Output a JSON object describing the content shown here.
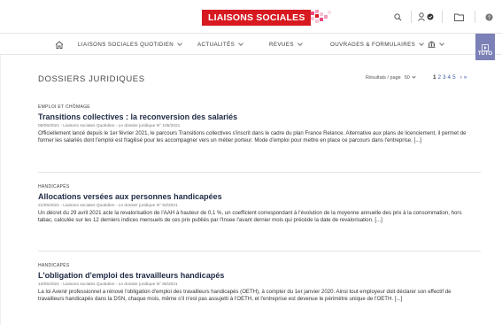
{
  "header": {
    "logo_text": "LIAISONS SOCIALES",
    "brand_color": "#d71920",
    "icons": [
      "search-icon",
      "user-icon",
      "folder-icon",
      "help-icon"
    ]
  },
  "nav": {
    "home_icon": "home-icon",
    "items": [
      {
        "label": "LIAISONS SOCIALES QUOTIDIEN"
      },
      {
        "label": "ACTUALITÉS"
      },
      {
        "label": "REVUES"
      },
      {
        "label": "OUVRAGES & FORMULAIRES"
      }
    ],
    "extra_icon": "bank-icon",
    "tuto_label": "TUTO"
  },
  "main": {
    "title": "DOSSIERS JURIDIQUES",
    "results_label": "Résultats / page",
    "results_value": "50",
    "pages": [
      "1",
      "2",
      "3",
      "4",
      "5"
    ],
    "next": "›",
    "last": "»"
  },
  "articles": [
    {
      "category": "EMPLOI ET CHÔMAGE",
      "title": "Transitions collectives : la reconversion des salariés",
      "meta": "09/06/2021 - Liaisons sociales Quotidien - Le dossier juridique N° 105/2021",
      "excerpt": "Officiellement lancé depuis le 1er février 2021, le parcours Transitions collectives s'inscrit dans le cadre du plan France Relance. Alternative aux plans de licenciement, il permet de former les salariés dont l'emploi est fragilisé pour les accompagner vers un métier porteur. Mode d'emploi pour mettre en place ce parcours dans l'entreprise. [...]"
    },
    {
      "category": "HANDICAPÉS",
      "title": "Allocations versées aux personnes handicapées",
      "meta": "21/05/2021 - Liaisons sociales Quotidien - Le dossier juridique N° 93/2021",
      "excerpt": "Un décret du 29 avril 2021 acte la revalorisation de l'AAH à hauteur de 0,1 %, un coefficient correspondant à l'évolution de la moyenne annuelle des prix à la consommation, hors tabac, calculée sur les 12 derniers indices mensuels de ces prix publiés par l'Insee l'avant dernier mois qui précède la date de revalorisation. [...]"
    },
    {
      "category": "HANDICAPÉS",
      "title": "L'obligation d'emploi des travailleurs handicapés",
      "meta": "10/05/2021 - Liaisons sociales Quotidien - Le dossier juridique N° 86/2021",
      "excerpt": "La loi Avenir professionnel a rénové l'obligation d'emploi des travailleurs handicapés (OETH), à compter du 1er janvier 2020. Ainsi tout employeur doit déclarer son effectif de travailleurs handicapés dans la DSN, chaque mois, même s'il n'est pas assujetti à l'OETH, et l'entreprise est devenue le périmètre unique de l'OETH. [...]"
    }
  ]
}
